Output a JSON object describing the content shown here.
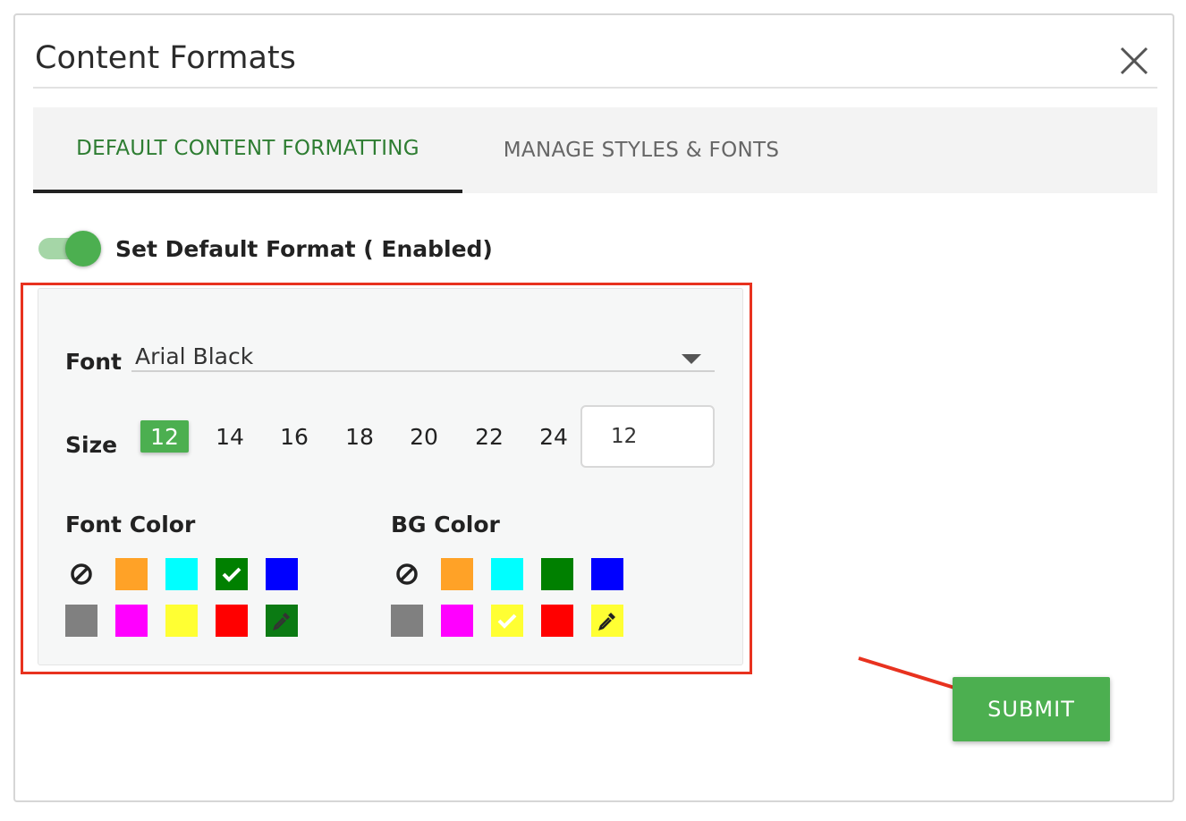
{
  "dialog": {
    "title": "Content Formats",
    "close_icon": "close-icon"
  },
  "tabs": [
    {
      "label": "DEFAULT CONTENT FORMATTING",
      "active": true
    },
    {
      "label": "MANAGE STYLES & FONTS",
      "active": false
    }
  ],
  "toggle": {
    "label": "Set Default Format ( Enabled)",
    "on": true
  },
  "font": {
    "label": "Font",
    "value": "Arial Black"
  },
  "size": {
    "label": "Size",
    "options": [
      "12",
      "14",
      "16",
      "18",
      "20",
      "22",
      "24"
    ],
    "selected": "12",
    "custom_value": "12"
  },
  "font_color": {
    "label": "Font Color",
    "swatches": [
      "none",
      "#ffa227",
      "#00ffff",
      "#008000",
      "#0000ff",
      "#808080",
      "#ff00ff",
      "#ffff33",
      "#ff0000",
      "#0b7a13"
    ],
    "selected": "#008000"
  },
  "bg_color": {
    "label": "BG Color",
    "swatches": [
      "none",
      "#ffa227",
      "#00ffff",
      "#008000",
      "#0000ff",
      "#808080",
      "#ff00ff",
      "#ffff33",
      "#ff0000",
      "#ffff33"
    ],
    "selected": "#ffff33"
  },
  "colors": {
    "accent": "#4caf50",
    "tab_active": "#2e7d32",
    "annotation": "#e8321f"
  },
  "submit": {
    "label": "SUBMIT"
  }
}
